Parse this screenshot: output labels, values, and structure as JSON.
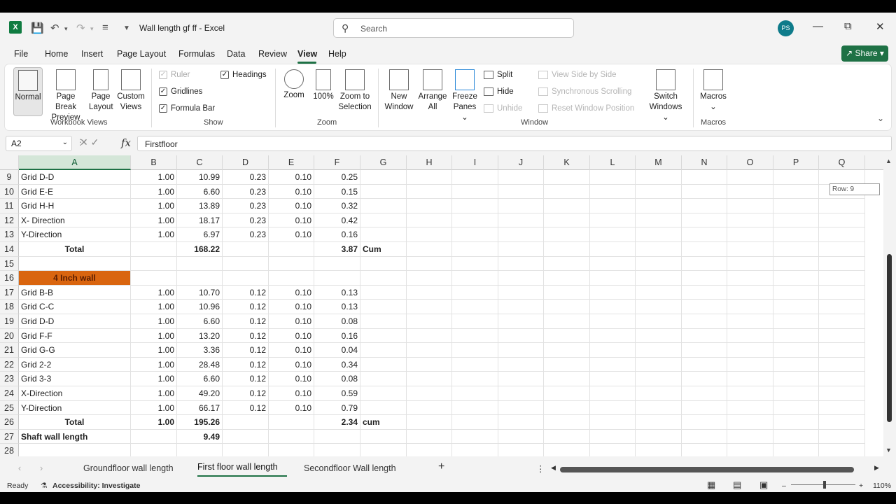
{
  "window": {
    "doc_title": "Wall length gf ff  -  Excel",
    "search_placeholder": "Search",
    "avatar_initials": "PS"
  },
  "menu": {
    "items": [
      "File",
      "Home",
      "Insert",
      "Page Layout",
      "Formulas",
      "Data",
      "Review",
      "View",
      "Help"
    ],
    "active": "View",
    "share_label": "Share"
  },
  "ribbon": {
    "workbook_views": {
      "label": "Workbook Views",
      "normal": "Normal",
      "page_break_1": "Page Break",
      "page_break_2": "Preview",
      "page_layout_1": "Page",
      "page_layout_2": "Layout",
      "custom_1": "Custom",
      "custom_2": "Views"
    },
    "show": {
      "label": "Show",
      "ruler": "Ruler",
      "gridlines": "Gridlines",
      "formula_bar": "Formula Bar",
      "headings": "Headings"
    },
    "zoom": {
      "label": "Zoom",
      "zoom": "Zoom",
      "hundred": "100%",
      "sel_1": "Zoom to",
      "sel_2": "Selection"
    },
    "window": {
      "label": "Window",
      "new_1": "New",
      "new_2": "Window",
      "arrange_1": "Arrange",
      "arrange_2": "All",
      "freeze_1": "Freeze",
      "freeze_2": "Panes",
      "split": "Split",
      "hide": "Hide",
      "unhide": "Unhide",
      "side_by_side": "View Side by Side",
      "sync_scroll": "Synchronous Scrolling",
      "reset_pos": "Reset Window Position",
      "switch_1": "Switch",
      "switch_2": "Windows"
    },
    "macros": {
      "label": "Macros",
      "btn": "Macros"
    }
  },
  "formula_bar": {
    "name_box": "A2",
    "formula": "Firstfloor"
  },
  "sheet": {
    "columns": [
      "A",
      "B",
      "C",
      "D",
      "E",
      "F",
      "G",
      "H",
      "I",
      "J",
      "K",
      "L",
      "M",
      "N",
      "O",
      "P",
      "Q"
    ],
    "row_tooltip": "Row: 9",
    "rows": [
      {
        "n": "9",
        "a": "Grid D-D",
        "b": "1.00",
        "c": "10.99",
        "d": "0.23",
        "e": "0.10",
        "f": "0.25",
        "g": ""
      },
      {
        "n": "10",
        "a": "Grid E-E",
        "b": "1.00",
        "c": "6.60",
        "d": "0.23",
        "e": "0.10",
        "f": "0.15",
        "g": ""
      },
      {
        "n": "11",
        "a": "Grid H-H",
        "b": "1.00",
        "c": "13.89",
        "d": "0.23",
        "e": "0.10",
        "f": "0.32",
        "g": ""
      },
      {
        "n": "12",
        "a": "X- Direction",
        "b": "1.00",
        "c": "18.17",
        "d": "0.23",
        "e": "0.10",
        "f": "0.42",
        "g": ""
      },
      {
        "n": "13",
        "a": "Y-Direction",
        "b": "1.00",
        "c": "6.97",
        "d": "0.23",
        "e": "0.10",
        "f": "0.16",
        "g": ""
      },
      {
        "n": "14",
        "a": "Total",
        "b": "",
        "c": "168.22",
        "d": "",
        "e": "",
        "f": "3.87",
        "g": "Cum",
        "style": "total"
      },
      {
        "n": "15",
        "a": "",
        "b": "",
        "c": "",
        "d": "",
        "e": "",
        "f": "",
        "g": ""
      },
      {
        "n": "16",
        "a": "4 Inch wall",
        "b": "",
        "c": "",
        "d": "",
        "e": "",
        "f": "",
        "g": "",
        "style": "header"
      },
      {
        "n": "17",
        "a": "Grid B-B",
        "b": "1.00",
        "c": "10.70",
        "d": "0.12",
        "e": "0.10",
        "f": "0.13",
        "g": ""
      },
      {
        "n": "18",
        "a": "Grid C-C",
        "b": "1.00",
        "c": "10.96",
        "d": "0.12",
        "e": "0.10",
        "f": "0.13",
        "g": ""
      },
      {
        "n": "19",
        "a": "Grid D-D",
        "b": "1.00",
        "c": "6.60",
        "d": "0.12",
        "e": "0.10",
        "f": "0.08",
        "g": ""
      },
      {
        "n": "20",
        "a": "Grid F-F",
        "b": "1.00",
        "c": "13.20",
        "d": "0.12",
        "e": "0.10",
        "f": "0.16",
        "g": ""
      },
      {
        "n": "21",
        "a": "Grid G-G",
        "b": "1.00",
        "c": "3.36",
        "d": "0.12",
        "e": "0.10",
        "f": "0.04",
        "g": ""
      },
      {
        "n": "22",
        "a": "Grid 2-2",
        "b": "1.00",
        "c": "28.48",
        "d": "0.12",
        "e": "0.10",
        "f": "0.34",
        "g": ""
      },
      {
        "n": "23",
        "a": "Grid 3-3",
        "b": "1.00",
        "c": "6.60",
        "d": "0.12",
        "e": "0.10",
        "f": "0.08",
        "g": ""
      },
      {
        "n": "24",
        "a": "X-Direction",
        "b": "1.00",
        "c": "49.20",
        "d": "0.12",
        "e": "0.10",
        "f": "0.59",
        "g": ""
      },
      {
        "n": "25",
        "a": "Y-Direction",
        "b": "1.00",
        "c": "66.17",
        "d": "0.12",
        "e": "0.10",
        "f": "0.79",
        "g": ""
      },
      {
        "n": "26",
        "a": "Total",
        "b": "1.00",
        "c": "195.26",
        "d": "",
        "e": "",
        "f": "2.34",
        "g": "cum",
        "style": "total"
      },
      {
        "n": "27",
        "a": "Shaft wall length",
        "b": "",
        "c": "9.49",
        "d": "",
        "e": "",
        "f": "",
        "g": "",
        "style": "shaft"
      },
      {
        "n": "28",
        "a": "",
        "b": "",
        "c": "",
        "d": "",
        "e": "",
        "f": "",
        "g": ""
      }
    ],
    "header_fill": "#d9650f"
  },
  "tabs": {
    "items": [
      "Groundfloor wall length",
      "First floor wall length",
      "Secondfloor Wall length"
    ],
    "active_index": 1,
    "add_label": "+"
  },
  "status": {
    "ready": "Ready",
    "accessibility": "Accessibility: Investigate",
    "zoom": "110%"
  }
}
